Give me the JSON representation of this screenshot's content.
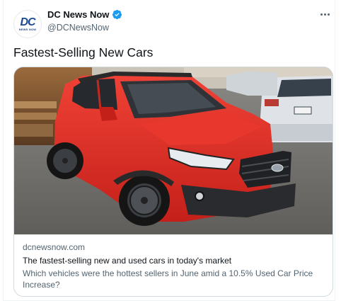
{
  "author": {
    "avatar_top": "DC",
    "avatar_bottom": "NEWS NOW",
    "name": "DC News Now",
    "handle": "@DCNewsNow"
  },
  "tweet": {
    "text": "Fastest-Selling New Cars"
  },
  "card": {
    "domain": "dcnewsnow.com",
    "title": "The fastest-selling new and used cars in today's market",
    "description": "Which vehicles were the hottest sellers in June amid a 10.5% Used Car Price Increase?",
    "image_alt": "red compact SUV in dealership showroom"
  },
  "colors": {
    "verified": "#1d9bf0",
    "car": "#e22a23",
    "brand": "#1c4a8f"
  },
  "icons": {
    "verified": "verified-badge-icon",
    "more": "more-options-icon"
  }
}
